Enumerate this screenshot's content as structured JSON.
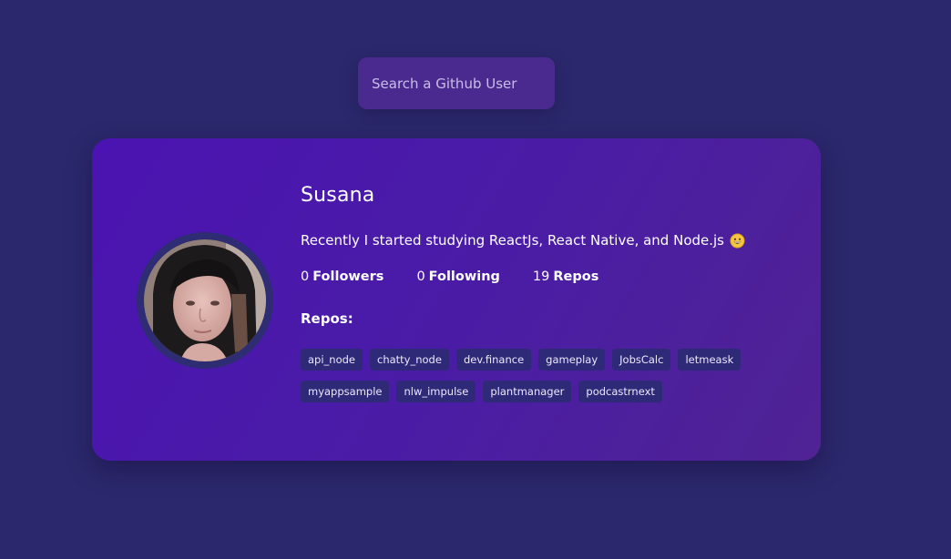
{
  "search": {
    "placeholder": "Search a Github User",
    "value": ""
  },
  "profile": {
    "name": "Susana",
    "bio": "Recently I started studying ReactJs, React Native, and Node.js",
    "bio_emoji": "grinning-face-icon",
    "stats": {
      "followers_count": "0",
      "followers_label": "Followers",
      "following_count": "0",
      "following_label": "Following",
      "repos_count": "19",
      "repos_label": "Repos"
    },
    "repos_title": "Repos:",
    "repos": [
      "api_node",
      "chatty_node",
      "dev.finance",
      "gameplay",
      "JobsCalc",
      "letmeask",
      "myappsample",
      "nlw_impulse",
      "plantmanager",
      "podcastrnext"
    ]
  },
  "colors": {
    "background": "#2c286d",
    "card_gradient_start": "#4b13b2",
    "card_gradient_end": "#4f2394",
    "search_box": "#4a2a8e",
    "repo_tag": "#2f2a77",
    "avatar_border": "#2e2c73"
  }
}
